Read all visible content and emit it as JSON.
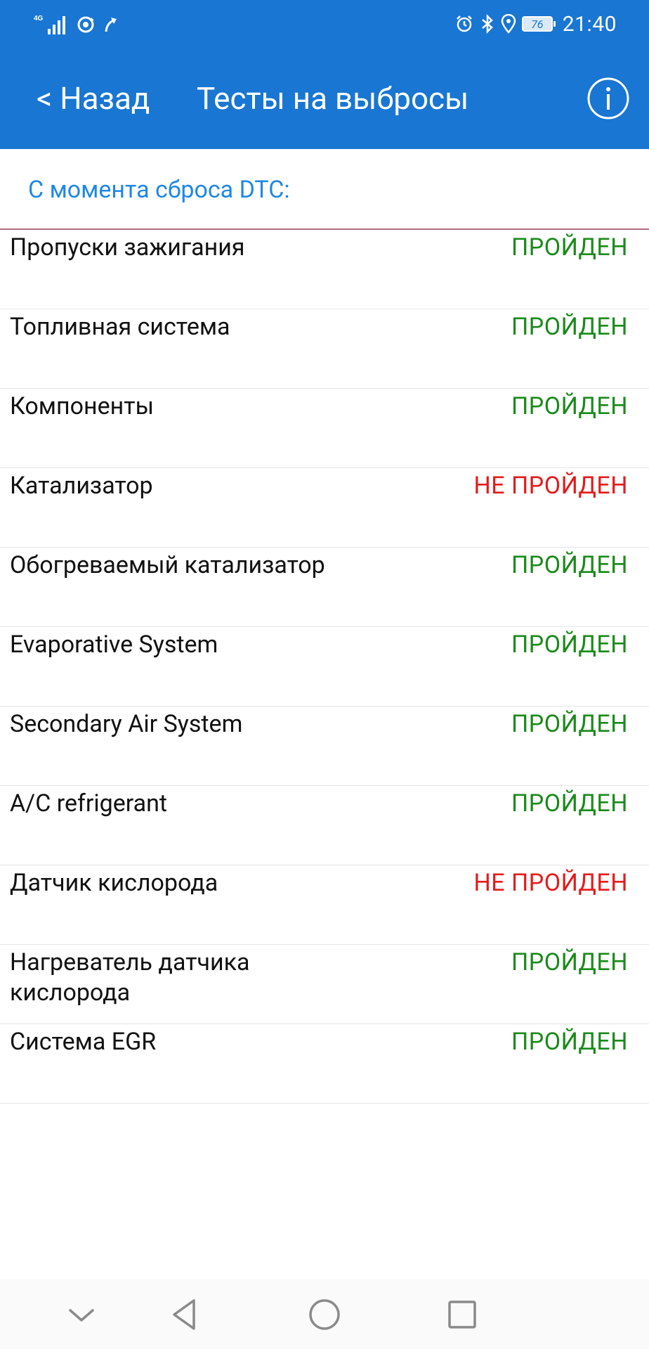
{
  "status_bar": {
    "network": "4G",
    "battery": "76",
    "time": "21:40"
  },
  "app_bar": {
    "back_label": "< Назад",
    "title": "Тесты на выбросы"
  },
  "section_header": "С момента сброса DTC:",
  "tests": [
    {
      "name": "Пропуски зажигания",
      "status": "ПРОЙДЕН",
      "passed": true
    },
    {
      "name": "Топливная система",
      "status": "ПРОЙДЕН",
      "passed": true
    },
    {
      "name": "Компоненты",
      "status": "ПРОЙДЕН",
      "passed": true
    },
    {
      "name": "Катализатор",
      "status": "НЕ ПРОЙДЕН",
      "passed": false
    },
    {
      "name": "Обогреваемый катализатор",
      "status": "ПРОЙДЕН",
      "passed": true
    },
    {
      "name": "Evaporative System",
      "status": "ПРОЙДЕН",
      "passed": true
    },
    {
      "name": "Secondary Air System",
      "status": "ПРОЙДЕН",
      "passed": true
    },
    {
      "name": "A/C refrigerant",
      "status": "ПРОЙДЕН",
      "passed": true
    },
    {
      "name": "Датчик кислорода",
      "status": "НЕ ПРОЙДЕН",
      "passed": false
    },
    {
      "name": "Нагреватель датчика кислорода",
      "status": "ПРОЙДЕН",
      "passed": true
    },
    {
      "name": "Система EGR",
      "status": "ПРОЙДЕН",
      "passed": true
    }
  ],
  "colors": {
    "app_bar": "#1976d2",
    "header_text": "#1e88e5",
    "passed": "#1a8a1a",
    "failed": "#e41b1b"
  },
  "icons": {
    "info": "info-circle-icon",
    "nav_hide": "chevron-down-icon",
    "nav_back": "triangle-back-icon",
    "nav_home": "circle-home-icon",
    "nav_recents": "square-recents-icon"
  }
}
